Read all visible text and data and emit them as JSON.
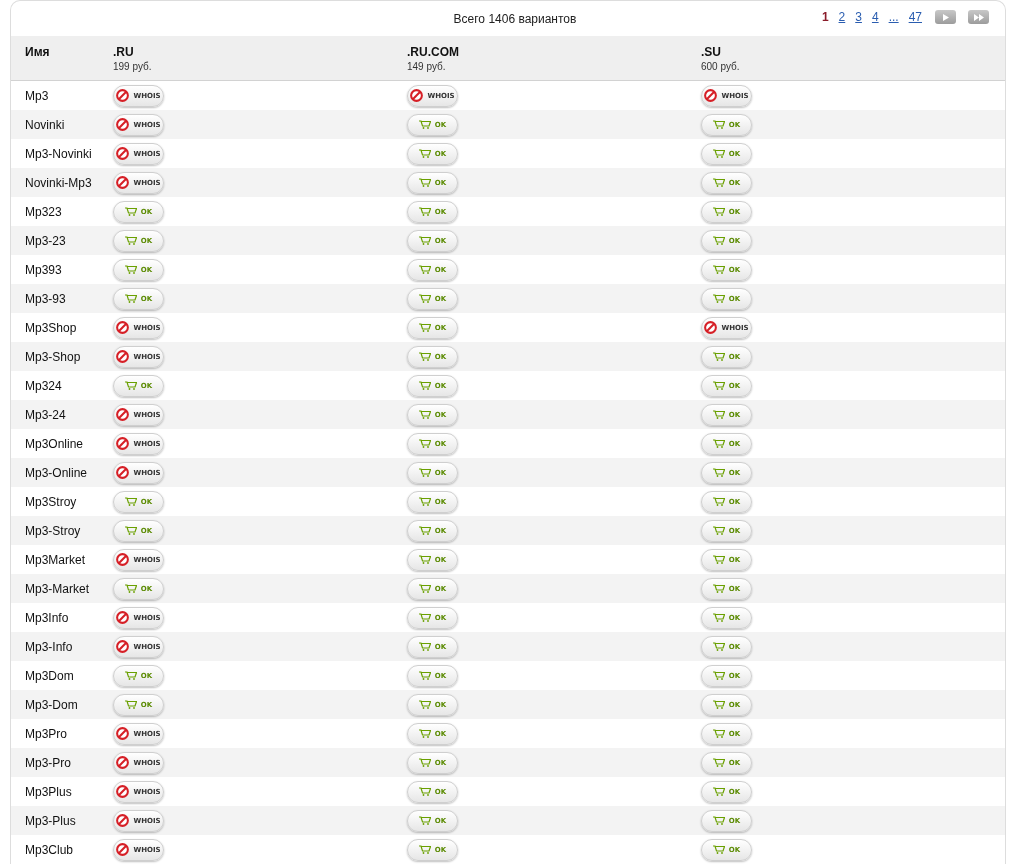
{
  "summary": "Всего 1406 вариантов",
  "pagination": [
    {
      "label": "1",
      "selected": true
    },
    {
      "label": "2",
      "selected": false
    },
    {
      "label": "3",
      "selected": false
    },
    {
      "label": "4",
      "selected": false
    },
    {
      "label": "...",
      "selected": false
    },
    {
      "label": "47",
      "selected": false
    }
  ],
  "columns": [
    {
      "name": "Имя"
    },
    {
      "name": ".RU",
      "price": "199 руб."
    },
    {
      "name": ".RU.COM",
      "price": "149 руб."
    },
    {
      "name": ".SU",
      "price": "600 руб."
    }
  ],
  "rows": [
    {
      "name": "Mp3",
      "cells": [
        {
          "kind": "whois",
          "label": "WHOIS"
        },
        {
          "kind": "whois",
          "label": "WHOIS"
        },
        {
          "kind": "whois",
          "label": "WHOIS"
        }
      ]
    },
    {
      "name": "Novinki",
      "cells": [
        {
          "kind": "whois",
          "label": "WHOIS"
        },
        {
          "kind": "ok",
          "label": "OK"
        },
        {
          "kind": "ok",
          "label": "OK"
        }
      ]
    },
    {
      "name": "Mp3-Novinki",
      "cells": [
        {
          "kind": "whois",
          "label": "WHOIS"
        },
        {
          "kind": "ok",
          "label": "OK"
        },
        {
          "kind": "ok",
          "label": "OK"
        }
      ]
    },
    {
      "name": "Novinki-Mp3",
      "cells": [
        {
          "kind": "whois",
          "label": "WHOIS"
        },
        {
          "kind": "ok",
          "label": "OK"
        },
        {
          "kind": "ok",
          "label": "OK"
        }
      ]
    },
    {
      "name": "Mp323",
      "cells": [
        {
          "kind": "ok",
          "label": "OK"
        },
        {
          "kind": "ok",
          "label": "OK"
        },
        {
          "kind": "ok",
          "label": "OK"
        }
      ]
    },
    {
      "name": "Mp3-23",
      "cells": [
        {
          "kind": "ok",
          "label": "OK"
        },
        {
          "kind": "ok",
          "label": "OK"
        },
        {
          "kind": "ok",
          "label": "OK"
        }
      ]
    },
    {
      "name": "Mp393",
      "cells": [
        {
          "kind": "ok",
          "label": "OK"
        },
        {
          "kind": "ok",
          "label": "OK"
        },
        {
          "kind": "ok",
          "label": "OK"
        }
      ]
    },
    {
      "name": "Mp3-93",
      "cells": [
        {
          "kind": "ok",
          "label": "OK"
        },
        {
          "kind": "ok",
          "label": "OK"
        },
        {
          "kind": "ok",
          "label": "OK"
        }
      ]
    },
    {
      "name": "Mp3Shop",
      "cells": [
        {
          "kind": "whois",
          "label": "WHOIS"
        },
        {
          "kind": "ok",
          "label": "OK"
        },
        {
          "kind": "whois",
          "label": "WHOIS"
        }
      ]
    },
    {
      "name": "Mp3-Shop",
      "cells": [
        {
          "kind": "whois",
          "label": "WHOIS"
        },
        {
          "kind": "ok",
          "label": "OK"
        },
        {
          "kind": "ok",
          "label": "OK"
        }
      ]
    },
    {
      "name": "Mp324",
      "cells": [
        {
          "kind": "ok",
          "label": "OK"
        },
        {
          "kind": "ok",
          "label": "OK"
        },
        {
          "kind": "ok",
          "label": "OK"
        }
      ]
    },
    {
      "name": "Mp3-24",
      "cells": [
        {
          "kind": "whois",
          "label": "WHOIS"
        },
        {
          "kind": "ok",
          "label": "OK"
        },
        {
          "kind": "ok",
          "label": "OK"
        }
      ]
    },
    {
      "name": "Mp3Online",
      "cells": [
        {
          "kind": "whois",
          "label": "WHOIS"
        },
        {
          "kind": "ok",
          "label": "OK"
        },
        {
          "kind": "ok",
          "label": "OK"
        }
      ]
    },
    {
      "name": "Mp3-Online",
      "cells": [
        {
          "kind": "whois",
          "label": "WHOIS"
        },
        {
          "kind": "ok",
          "label": "OK"
        },
        {
          "kind": "ok",
          "label": "OK"
        }
      ]
    },
    {
      "name": "Mp3Stroy",
      "cells": [
        {
          "kind": "ok",
          "label": "OK"
        },
        {
          "kind": "ok",
          "label": "OK"
        },
        {
          "kind": "ok",
          "label": "OK"
        }
      ]
    },
    {
      "name": "Mp3-Stroy",
      "cells": [
        {
          "kind": "ok",
          "label": "OK"
        },
        {
          "kind": "ok",
          "label": "OK"
        },
        {
          "kind": "ok",
          "label": "OK"
        }
      ]
    },
    {
      "name": "Mp3Market",
      "cells": [
        {
          "kind": "whois",
          "label": "WHOIS"
        },
        {
          "kind": "ok",
          "label": "OK"
        },
        {
          "kind": "ok",
          "label": "OK"
        }
      ]
    },
    {
      "name": "Mp3-Market",
      "cells": [
        {
          "kind": "ok",
          "label": "OK"
        },
        {
          "kind": "ok",
          "label": "OK"
        },
        {
          "kind": "ok",
          "label": "OK"
        }
      ]
    },
    {
      "name": "Mp3Info",
      "cells": [
        {
          "kind": "whois",
          "label": "WHOIS"
        },
        {
          "kind": "ok",
          "label": "OK"
        },
        {
          "kind": "ok",
          "label": "OK"
        }
      ]
    },
    {
      "name": "Mp3-Info",
      "cells": [
        {
          "kind": "whois",
          "label": "WHOIS"
        },
        {
          "kind": "ok",
          "label": "OK"
        },
        {
          "kind": "ok",
          "label": "OK"
        }
      ]
    },
    {
      "name": "Mp3Dom",
      "cells": [
        {
          "kind": "ok",
          "label": "OK"
        },
        {
          "kind": "ok",
          "label": "OK"
        },
        {
          "kind": "ok",
          "label": "OK"
        }
      ]
    },
    {
      "name": "Mp3-Dom",
      "cells": [
        {
          "kind": "ok",
          "label": "OK"
        },
        {
          "kind": "ok",
          "label": "OK"
        },
        {
          "kind": "ok",
          "label": "OK"
        }
      ]
    },
    {
      "name": "Mp3Pro",
      "cells": [
        {
          "kind": "whois",
          "label": "WHOIS"
        },
        {
          "kind": "ok",
          "label": "OK"
        },
        {
          "kind": "ok",
          "label": "OK"
        }
      ]
    },
    {
      "name": "Mp3-Pro",
      "cells": [
        {
          "kind": "whois",
          "label": "WHOIS"
        },
        {
          "kind": "ok",
          "label": "OK"
        },
        {
          "kind": "ok",
          "label": "OK"
        }
      ]
    },
    {
      "name": "Mp3Plus",
      "cells": [
        {
          "kind": "whois",
          "label": "WHOIS"
        },
        {
          "kind": "ok",
          "label": "OK"
        },
        {
          "kind": "ok",
          "label": "OK"
        }
      ]
    },
    {
      "name": "Mp3-Plus",
      "cells": [
        {
          "kind": "whois",
          "label": "WHOIS"
        },
        {
          "kind": "ok",
          "label": "OK"
        },
        {
          "kind": "ok",
          "label": "OK"
        }
      ]
    },
    {
      "name": "Mp3Club",
      "cells": [
        {
          "kind": "whois",
          "label": "WHOIS"
        },
        {
          "kind": "ok",
          "label": "OK"
        },
        {
          "kind": "ok",
          "label": "OK"
        }
      ]
    }
  ]
}
